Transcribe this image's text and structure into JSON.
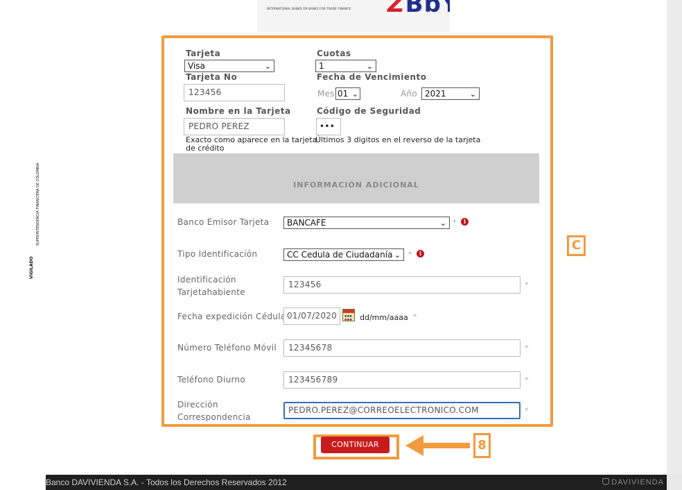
{
  "header": {
    "logo_small_text": "INTERNATIONAL BANKS OR BANKS FOR TRADE FINANCE",
    "logo_brand_part1": "Z",
    "logo_brand_part2": "BbY"
  },
  "sidebar": {
    "vigilado_label": "VIGILADO",
    "superintendencia_label": "SUPERINTENDENCIA FINANCIERA DE COLOMBIA"
  },
  "card": {
    "tarjeta_label": "Tarjeta",
    "tarjeta_value": "Visa",
    "cuotas_label": "Cuotas",
    "cuotas_value": "1",
    "tarjeta_no_label": "Tarjeta No",
    "tarjeta_no_value": "123456",
    "vencimiento_label": "Fecha de Vencimiento",
    "mes_label": "Mes",
    "mes_value": "01",
    "ano_label": "Año",
    "ano_value": "2021",
    "nombre_label": "Nombre en la Tarjeta",
    "nombre_value": "PEDRO PEREZ",
    "codigo_label": "Código de Seguridad",
    "codigo_value": "•••",
    "nombre_hint_line1": "Exacto como aparece en la tarjeta",
    "nombre_hint_line2": "de crédito",
    "codigo_hint": "Últimos 3 digitos en el reverso de la tarjeta"
  },
  "additional": {
    "section_title": "INFORMACIÓN ADICIONAL",
    "banco_label": "Banco Emisor Tarjeta",
    "banco_value": "BANCAFE",
    "tipo_id_label": "Tipo Identificación",
    "tipo_id_value": "CC Cedula de Ciudadanía",
    "identificacion_label_line1": "Identificación",
    "identificacion_label_line2": "Tarjetahabiente",
    "identificacion_value": "123456",
    "fecha_exp_label": "Fecha expedición Cédula",
    "fecha_exp_value": "01/07/2020",
    "fecha_format": "dd/mm/aaaa",
    "movil_label": "Número Teléfono Móvil",
    "movil_value": "12345678",
    "diurno_label": "Teléfono Diurno",
    "diurno_value": "123456789",
    "direccion_label_line1": "Dirección",
    "direccion_label_line2": "Correspondencia",
    "direccion_value": "PEDRO.PEREZ@CORREOELECTRONICO.COM",
    "required_mark": "*",
    "info_glyph": "i"
  },
  "actions": {
    "continue_label": "CONTINUAR"
  },
  "annotations": {
    "frame_badge": "C",
    "step_badge": "8",
    "accent_color": "#f39a3d"
  },
  "footer": {
    "copyright": "Banco DAVIVIENDA S.A. - Todos los Derechos Reservados 2012",
    "brand": "DAVIVIENDA"
  },
  "colors": {
    "button_red": "#c81c1c",
    "info_red": "#c0161c",
    "focus_blue": "#2f6fb5",
    "footer_bg": "#1f1f1f",
    "section_band": "#cfcfcf"
  }
}
